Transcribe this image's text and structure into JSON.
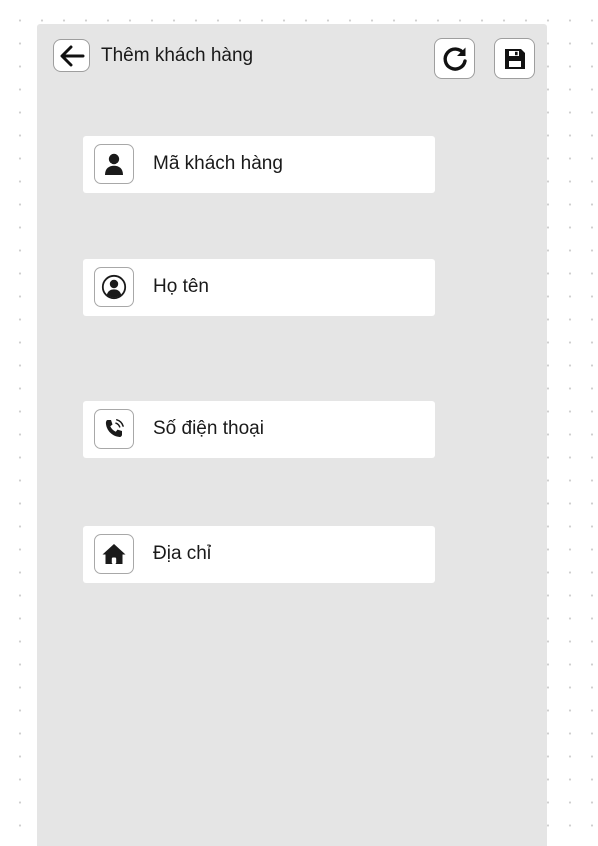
{
  "header": {
    "title": "Thêm khách hàng",
    "back_icon": "arrow-left-icon",
    "refresh_icon": "refresh-icon",
    "save_icon": "floppy-disk-icon"
  },
  "form": {
    "fields": [
      {
        "label": "Mã khách hàng",
        "icon": "user-icon"
      },
      {
        "label": "Họ tên",
        "icon": "user-circle-icon"
      },
      {
        "label": "Số điện thoại",
        "icon": "phone-icon"
      },
      {
        "label": "Địa chỉ",
        "icon": "home-icon"
      }
    ]
  },
  "colors": {
    "panel_background": "#e5e5e5",
    "field_background": "#ffffff",
    "icon_color": "#1a1a1a",
    "border": "#a8a8a8"
  }
}
